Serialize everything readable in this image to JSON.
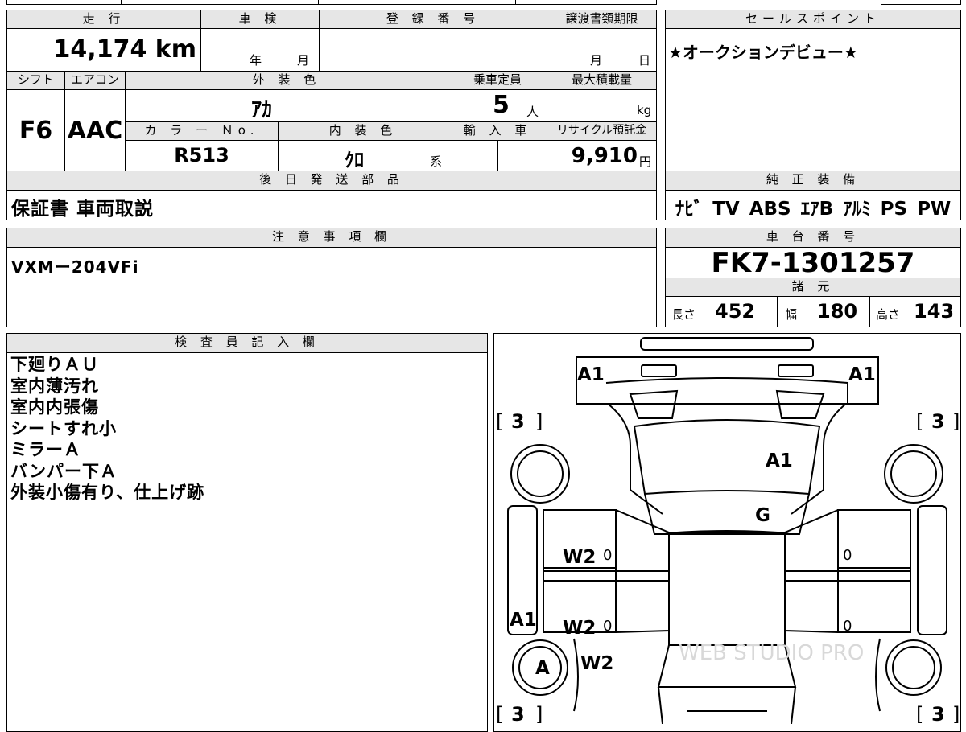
{
  "mileage": {
    "label": "走 行",
    "value": "14,174",
    "unit": "km"
  },
  "inspection": {
    "label": "車 検",
    "year": "年",
    "month": "月"
  },
  "registration": {
    "label": "登 録 番 号",
    "value": ""
  },
  "transfer_deadline": {
    "label": "譲渡書類期限",
    "month": "月",
    "day": "日"
  },
  "selling_point": {
    "label": "セールスポイント",
    "text": "★オークションデビュー★"
  },
  "shift": {
    "label": "シフト",
    "value": "F6"
  },
  "aircon": {
    "label": "エアコン",
    "value": "AAC"
  },
  "exterior_color": {
    "label": "外 装 色",
    "value": "ｱｶ"
  },
  "capacity": {
    "label": "乗車定員",
    "value": "5",
    "unit": "人"
  },
  "max_load": {
    "label": "最大積載量",
    "value": "",
    "unit": "kg"
  },
  "color_no": {
    "label": "カ ラ ー Ｎo.",
    "value": "R513"
  },
  "interior_color": {
    "label": "内 装 色",
    "value": "ｸﾛ",
    "unit": "系"
  },
  "import": {
    "label": "輸 入 車",
    "value": ""
  },
  "recycle_fee": {
    "label": "リサイクル預託金",
    "value": "9,910",
    "unit": "円"
  },
  "parts": {
    "label": "後 日 発 送 部 品",
    "value": "保証書 車両取説"
  },
  "equipment": {
    "label": "純 正 装 備",
    "value": "ﾅﾋﾞ TV ABS ｴｱB ｱﾙﾐ PS PW"
  },
  "caution": {
    "label": "注 意 事 項 欄",
    "value": "VXMー204VFi"
  },
  "chassis": {
    "label": "車 台 番 号",
    "value": "FK7-1301257"
  },
  "specs": {
    "label": "諸 元",
    "length": {
      "label": "長さ",
      "value": "452"
    },
    "width": {
      "label": "幅",
      "value": "180"
    },
    "height": {
      "label": "高さ",
      "value": "143"
    }
  },
  "inspector": {
    "label": "検 査 員 記 入 欄",
    "lines": [
      "下廻りＡＵ",
      "室内薄汚れ",
      "室内内張傷",
      "シートすれ小",
      "ミラーＡ",
      "バンパー下Ａ",
      "外装小傷有り、仕上げ跡"
    ]
  },
  "diagram": {
    "marks": {
      "front_left": "A1",
      "front_right": "A1",
      "tire_fl": "3",
      "tire_fr": "3",
      "tire_rl": "3",
      "tire_rr": "3",
      "windshield": "A1",
      "hood": "G",
      "door_fl": "W2",
      "door_rl": "W2",
      "rocker_left": "A1",
      "wheel_rl": "A",
      "quarter_left": "W2",
      "door_fl_val": "0",
      "door_rl_val": "0",
      "door_fr_val": "0",
      "door_rr_val": "0"
    },
    "watermark": "WEB STUDIO PRO"
  }
}
